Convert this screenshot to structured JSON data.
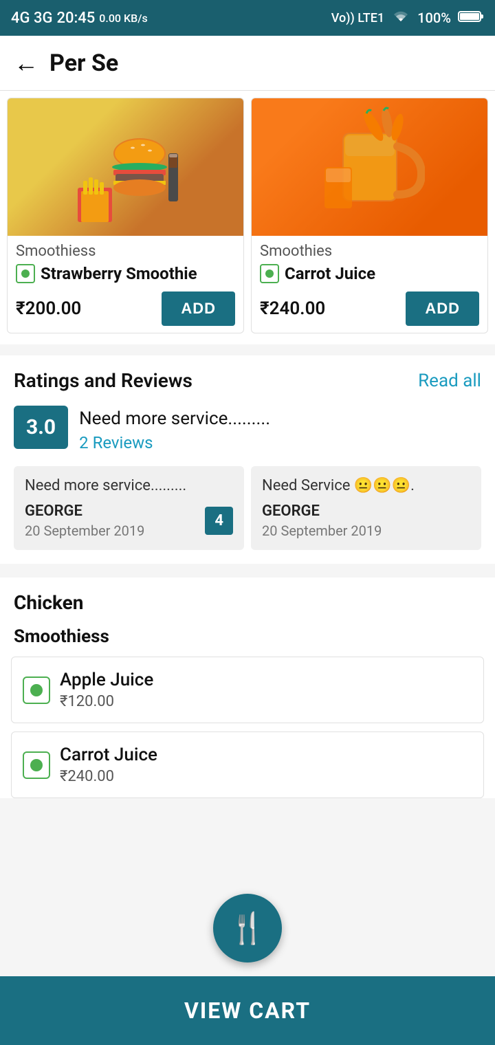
{
  "statusBar": {
    "time": "20:45",
    "network": "4G 3G",
    "speed": "0.00 KB/s",
    "signal": "Vo)) LTE1",
    "wifi": "WiFi",
    "battery": "100%"
  },
  "header": {
    "title": "Per Se",
    "backLabel": "←"
  },
  "products": [
    {
      "category": "Smoothiess",
      "name": "Strawberry Smoothie",
      "price": "₹200.00",
      "addLabel": "ADD",
      "imageType": "burger"
    },
    {
      "category": "Smoothies",
      "name": "Carrot Juice",
      "price": "₹240.00",
      "addLabel": "ADD",
      "imageType": "juice"
    }
  ],
  "ratings": {
    "sectionTitle": "Ratings and Reviews",
    "readAllLabel": "Read all",
    "score": "3.0",
    "summaryText": "Need more service.........",
    "reviewCount": "2 Reviews"
  },
  "reviews": [
    {
      "text": "Need more service.........",
      "author": "GEORGE",
      "date": "20 September 2019",
      "rating": "4"
    },
    {
      "text": "Need Service 😐😐😐.",
      "author": "GEORGE",
      "date": "20 September 2019",
      "rating": null
    }
  ],
  "menuSections": [
    {
      "title": "Chicken",
      "subcategories": [
        {
          "title": "Smoothiess",
          "items": [
            {
              "name": "Apple Juice",
              "price": "₹120.00"
            },
            {
              "name": "Carrot Juice",
              "price": "₹240.00"
            }
          ]
        }
      ]
    }
  ],
  "fab": {
    "icon": "🍴"
  },
  "viewCart": {
    "label": "VIEW CART"
  }
}
